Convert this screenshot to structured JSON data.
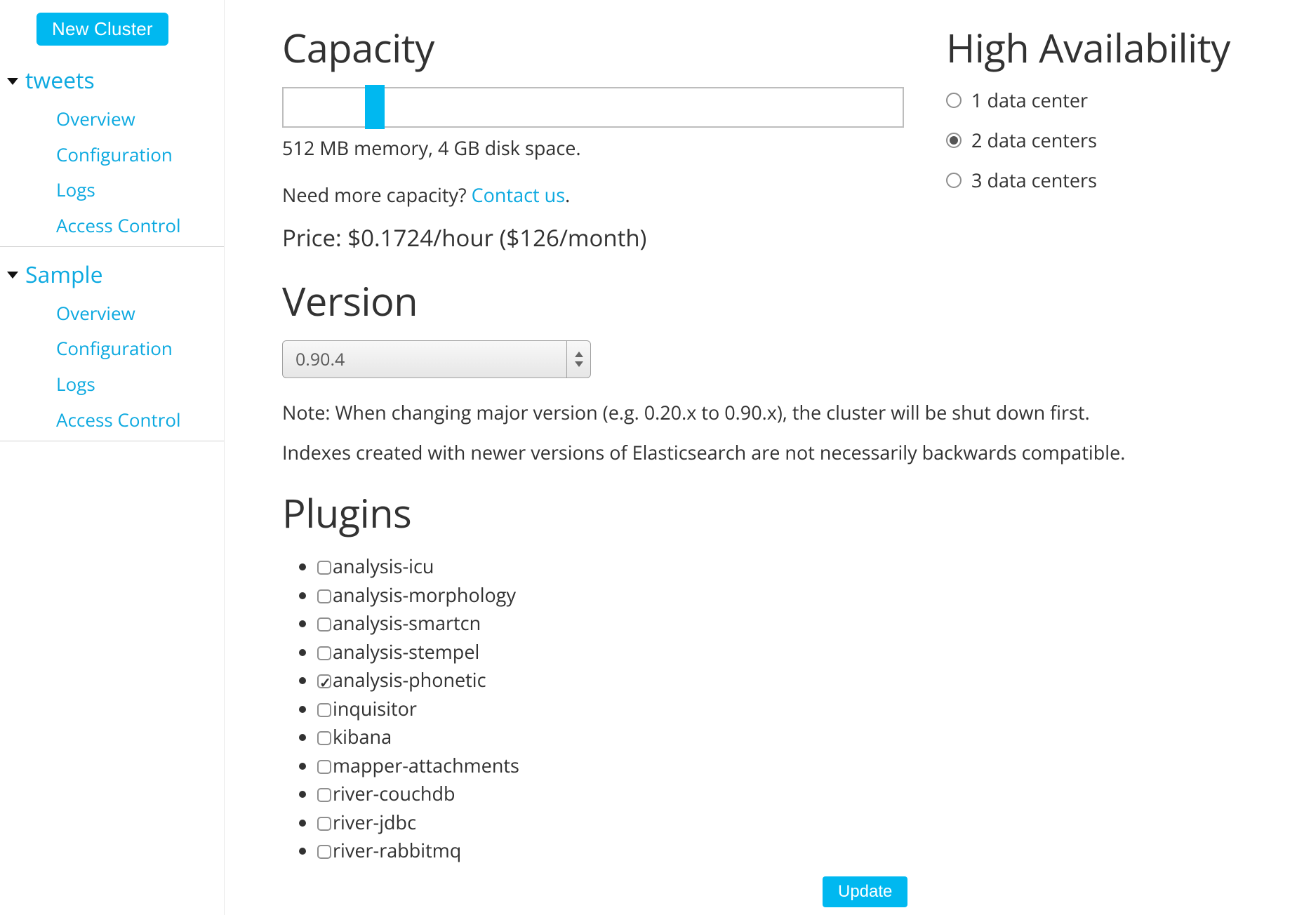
{
  "sidebar": {
    "new_cluster_label": "New Cluster",
    "clusters": [
      {
        "name": "tweets",
        "links": [
          {
            "label": "Overview"
          },
          {
            "label": "Configuration"
          },
          {
            "label": "Logs"
          },
          {
            "label": "Access Control"
          }
        ]
      },
      {
        "name": "Sample",
        "links": [
          {
            "label": "Overview"
          },
          {
            "label": "Configuration"
          },
          {
            "label": "Logs"
          },
          {
            "label": "Access Control"
          }
        ]
      }
    ]
  },
  "capacity": {
    "heading": "Capacity",
    "summary": "512 MB memory, 4 GB disk space.",
    "need_more_prefix": "Need more capacity? ",
    "contact_us_label": "Contact us",
    "need_more_suffix": ".",
    "price_line": "Price: $0.1724/hour ($126/month)"
  },
  "ha": {
    "heading": "High Availability",
    "options": [
      {
        "label": "1 data center",
        "selected": false
      },
      {
        "label": "2 data centers",
        "selected": true
      },
      {
        "label": "3 data centers",
        "selected": false
      }
    ]
  },
  "version": {
    "heading": "Version",
    "selected": "0.90.4",
    "note1": "Note: When changing major version (e.g. 0.20.x to 0.90.x), the cluster will be shut down first.",
    "note2": "Indexes created with newer versions of Elasticsearch are not necessarily backwards compatible."
  },
  "plugins": {
    "heading": "Plugins",
    "items": [
      {
        "label": "analysis-icu",
        "checked": false
      },
      {
        "label": "analysis-morphology",
        "checked": false
      },
      {
        "label": "analysis-smartcn",
        "checked": false
      },
      {
        "label": "analysis-stempel",
        "checked": false
      },
      {
        "label": "analysis-phonetic",
        "checked": true
      },
      {
        "label": "inquisitor",
        "checked": false
      },
      {
        "label": "kibana",
        "checked": false
      },
      {
        "label": "mapper-attachments",
        "checked": false
      },
      {
        "label": "river-couchdb",
        "checked": false
      },
      {
        "label": "river-jdbc",
        "checked": false
      },
      {
        "label": "river-rabbitmq",
        "checked": false
      }
    ]
  },
  "update_button_label": "Update"
}
